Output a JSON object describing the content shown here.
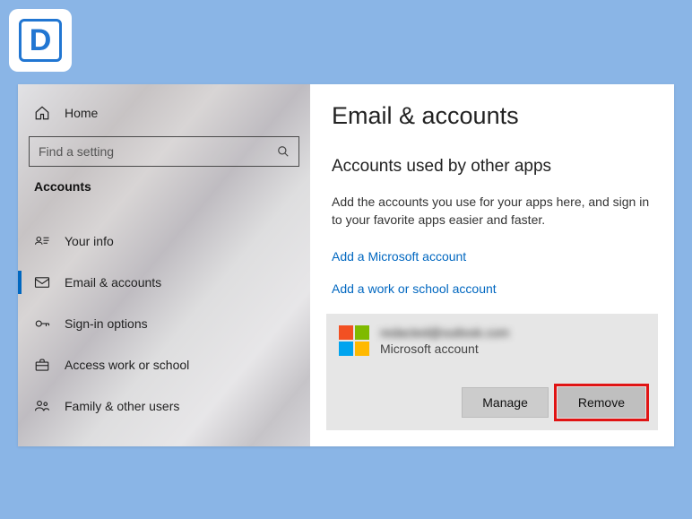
{
  "logo": {
    "letter": "D"
  },
  "sidebar": {
    "home": "Home",
    "search_placeholder": "Find a setting",
    "section": "Accounts",
    "items": [
      {
        "label": "Your info"
      },
      {
        "label": "Email & accounts"
      },
      {
        "label": "Sign-in options"
      },
      {
        "label": "Access work or school"
      },
      {
        "label": "Family & other users"
      }
    ]
  },
  "main": {
    "title": "Email & accounts",
    "subtitle": "Accounts used by other apps",
    "description": "Add the accounts you use for your apps here, and sign in to your favorite apps easier and faster.",
    "link_microsoft": "Add a Microsoft account",
    "link_workschool": "Add a work or school account",
    "account": {
      "email": "redacted@outlook.com",
      "type": "Microsoft account"
    },
    "manage": "Manage",
    "remove": "Remove"
  }
}
